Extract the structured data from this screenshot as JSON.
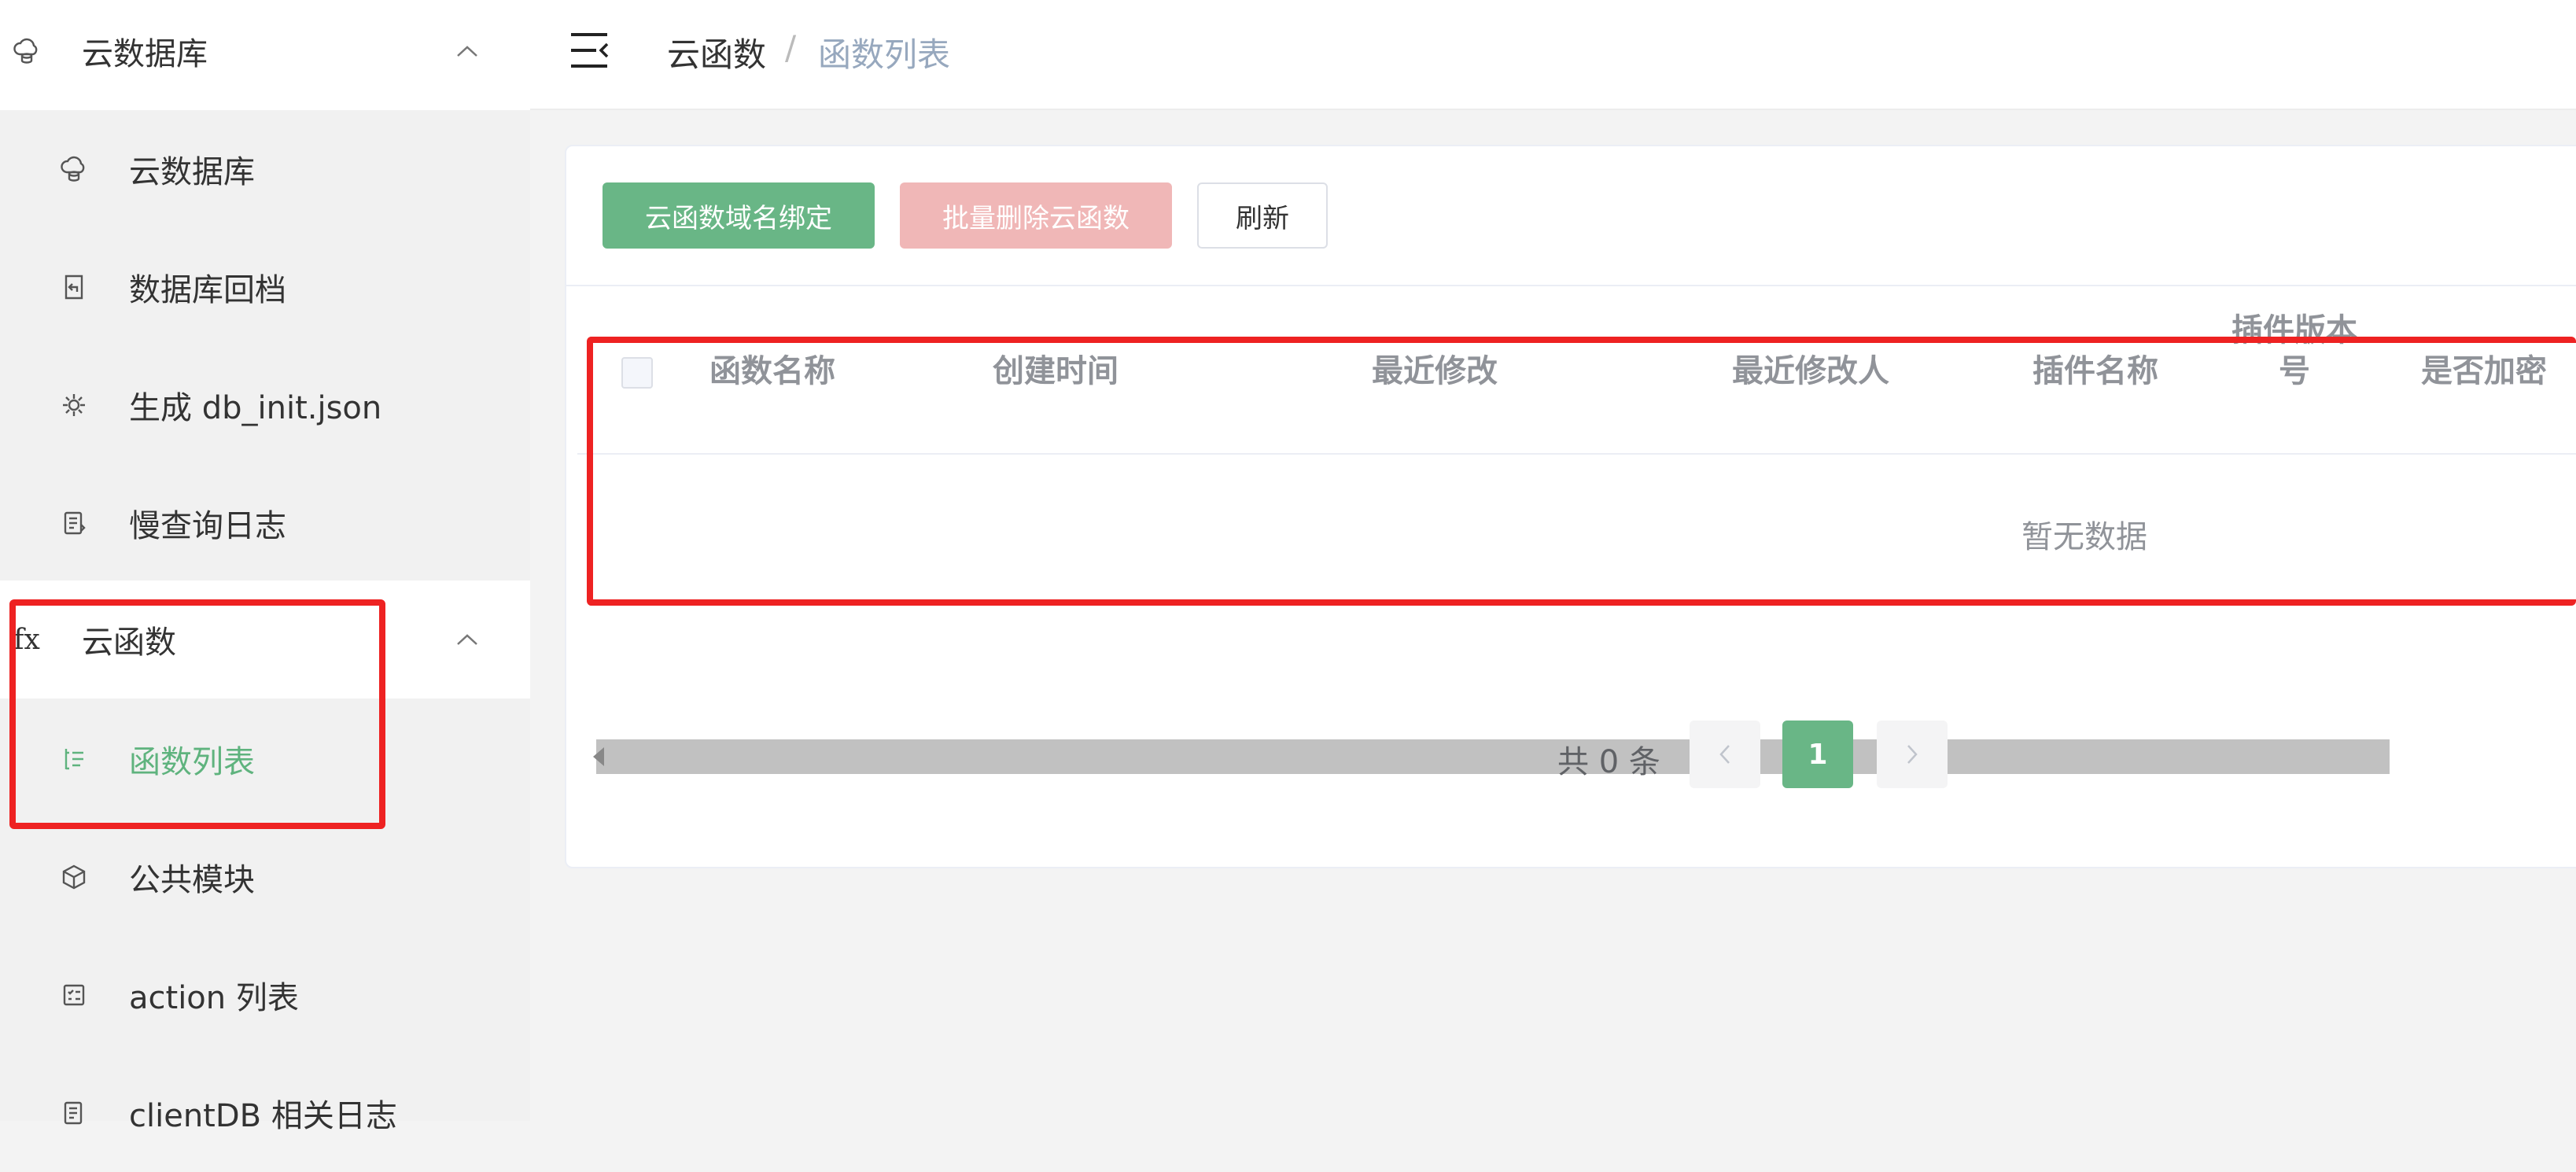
{
  "sidebar": {
    "group_database": {
      "label": "云数据库",
      "icon": "cloud-database-icon"
    },
    "database_items": [
      {
        "label": "云数据库",
        "icon": "cloud-database-icon"
      },
      {
        "label": "数据库回档",
        "icon": "rollback-icon"
      },
      {
        "label": "生成 db_init.json",
        "icon": "generate-icon"
      },
      {
        "label": "慢查询日志",
        "icon": "log-icon"
      }
    ],
    "group_functions": {
      "label": "云函数",
      "icon": "fx-icon",
      "icon_text": "fx"
    },
    "function_items": [
      {
        "label": "函数列表",
        "icon": "list-icon",
        "active": true
      },
      {
        "label": "公共模块",
        "icon": "cube-icon"
      },
      {
        "label": "action 列表",
        "icon": "action-list-icon"
      },
      {
        "label": "clientDB 相关日志",
        "icon": "log-icon"
      }
    ]
  },
  "header": {
    "menu_icon": "menu-fold-icon",
    "breadcrumb_root": "云函数",
    "breadcrumb_separator": "/",
    "breadcrumb_current": "函数列表"
  },
  "toolbar": {
    "bind_domain": "云函数域名绑定",
    "batch_delete": "批量删除云函数",
    "refresh": "刷新"
  },
  "table": {
    "columns": [
      "函数名称",
      "创建时间",
      "最近修改",
      "最近修改人",
      "插件名称",
      "插件版本号",
      "是否加密"
    ],
    "empty_text": "暂无数据"
  },
  "pagination": {
    "total_text": "共 0 条",
    "current_page": "1"
  },
  "colors": {
    "accent_green": "#69b686",
    "danger_light": "#f0b7b7",
    "highlight_red": "#ee2222",
    "breadcrumb_muted": "#97a8be"
  }
}
